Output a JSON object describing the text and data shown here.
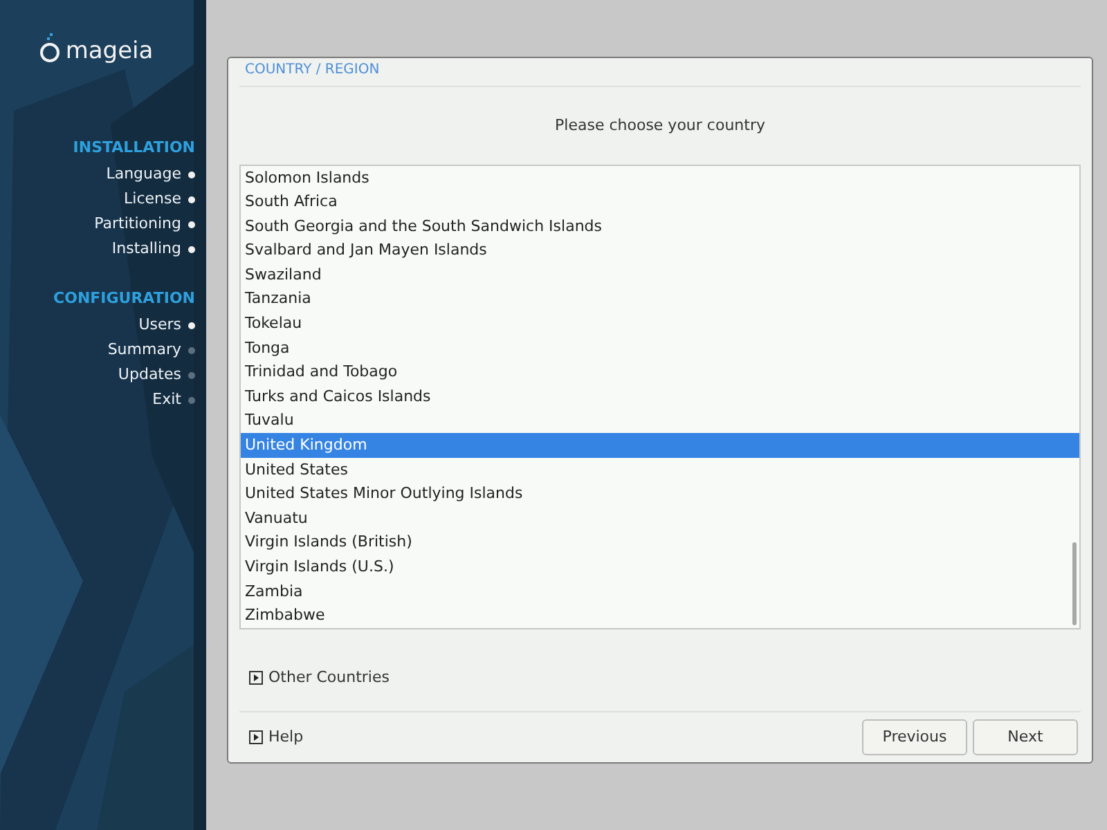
{
  "logo": {
    "text": "mageia"
  },
  "sidebar": [
    {
      "title": "INSTALLATION",
      "items": [
        {
          "label": "Language",
          "done": true
        },
        {
          "label": "License",
          "done": true
        },
        {
          "label": "Partitioning",
          "done": true
        },
        {
          "label": "Installing",
          "done": true
        }
      ]
    },
    {
      "title": "CONFIGURATION",
      "items": [
        {
          "label": "Users",
          "done": true
        },
        {
          "label": "Summary",
          "done": false
        },
        {
          "label": "Updates",
          "done": false
        },
        {
          "label": "Exit",
          "done": false
        }
      ]
    }
  ],
  "dialog": {
    "title": "COUNTRY / REGION",
    "prompt": "Please choose your country",
    "countries": [
      {
        "label": "Solomon Islands",
        "selected": false
      },
      {
        "label": "South Africa",
        "selected": false
      },
      {
        "label": "South Georgia and the South Sandwich Islands",
        "selected": false
      },
      {
        "label": "Svalbard and Jan Mayen Islands",
        "selected": false
      },
      {
        "label": "Swaziland",
        "selected": false
      },
      {
        "label": "Tanzania",
        "selected": false
      },
      {
        "label": "Tokelau",
        "selected": false
      },
      {
        "label": "Tonga",
        "selected": false
      },
      {
        "label": "Trinidad and Tobago",
        "selected": false
      },
      {
        "label": "Turks and Caicos Islands",
        "selected": false
      },
      {
        "label": "Tuvalu",
        "selected": false
      },
      {
        "label": "United Kingdom",
        "selected": true
      },
      {
        "label": "United States",
        "selected": false
      },
      {
        "label": "United States Minor Outlying Islands",
        "selected": false
      },
      {
        "label": "Vanuatu",
        "selected": false
      },
      {
        "label": "Virgin Islands (British)",
        "selected": false
      },
      {
        "label": "Virgin Islands (U.S.)",
        "selected": false
      },
      {
        "label": "Zambia",
        "selected": false
      },
      {
        "label": "Zimbabwe",
        "selected": false
      }
    ],
    "other_countries": {
      "label": "Other Countries",
      "expanded": false
    },
    "help": {
      "label": "Help",
      "expanded": false
    },
    "buttons": [
      "Previous",
      "Next"
    ]
  }
}
